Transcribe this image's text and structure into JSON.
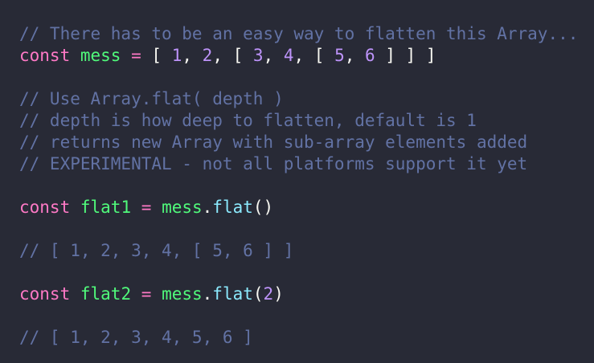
{
  "theme": {
    "background": "#282a36",
    "comment": "#6272a4",
    "keyword": "#ff79c6",
    "variable": "#50fa7b",
    "number": "#bd93f9",
    "method": "#8be9fd",
    "text": "#f8f8f2"
  },
  "lines": [
    {
      "tokens": [
        {
          "t": "// There has to be an easy way to flatten this Array...",
          "c": "comment"
        }
      ]
    },
    {
      "tokens": [
        {
          "t": "const",
          "c": "keyword"
        },
        {
          "t": " ",
          "c": "text"
        },
        {
          "t": "mess",
          "c": "variable"
        },
        {
          "t": " ",
          "c": "text"
        },
        {
          "t": "=",
          "c": "keyword"
        },
        {
          "t": " [ ",
          "c": "text"
        },
        {
          "t": "1",
          "c": "number"
        },
        {
          "t": ", ",
          "c": "text"
        },
        {
          "t": "2",
          "c": "number"
        },
        {
          "t": ", [ ",
          "c": "text"
        },
        {
          "t": "3",
          "c": "number"
        },
        {
          "t": ", ",
          "c": "text"
        },
        {
          "t": "4",
          "c": "number"
        },
        {
          "t": ", [ ",
          "c": "text"
        },
        {
          "t": "5",
          "c": "number"
        },
        {
          "t": ", ",
          "c": "text"
        },
        {
          "t": "6",
          "c": "number"
        },
        {
          "t": " ] ] ]",
          "c": "text"
        }
      ]
    },
    {
      "blank": true
    },
    {
      "tokens": [
        {
          "t": "// Use Array.flat( depth )",
          "c": "comment"
        }
      ]
    },
    {
      "tokens": [
        {
          "t": "// depth is how deep to flatten, default is 1",
          "c": "comment"
        }
      ]
    },
    {
      "tokens": [
        {
          "t": "// returns new Array with sub-array elements added",
          "c": "comment"
        }
      ]
    },
    {
      "tokens": [
        {
          "t": "// EXPERIMENTAL - not all platforms support it yet",
          "c": "comment"
        }
      ]
    },
    {
      "blank": true
    },
    {
      "tokens": [
        {
          "t": "const",
          "c": "keyword"
        },
        {
          "t": " ",
          "c": "text"
        },
        {
          "t": "flat1",
          "c": "variable"
        },
        {
          "t": " ",
          "c": "text"
        },
        {
          "t": "=",
          "c": "keyword"
        },
        {
          "t": " ",
          "c": "text"
        },
        {
          "t": "mess",
          "c": "variable"
        },
        {
          "t": ".",
          "c": "text"
        },
        {
          "t": "flat",
          "c": "method"
        },
        {
          "t": "()",
          "c": "text"
        }
      ]
    },
    {
      "blank": true
    },
    {
      "tokens": [
        {
          "t": "// [ 1, 2, 3, 4, [ 5, 6 ] ]",
          "c": "comment"
        }
      ]
    },
    {
      "blank": true
    },
    {
      "tokens": [
        {
          "t": "const",
          "c": "keyword"
        },
        {
          "t": " ",
          "c": "text"
        },
        {
          "t": "flat2",
          "c": "variable"
        },
        {
          "t": " ",
          "c": "text"
        },
        {
          "t": "=",
          "c": "keyword"
        },
        {
          "t": " ",
          "c": "text"
        },
        {
          "t": "mess",
          "c": "variable"
        },
        {
          "t": ".",
          "c": "text"
        },
        {
          "t": "flat",
          "c": "method"
        },
        {
          "t": "(",
          "c": "text"
        },
        {
          "t": "2",
          "c": "number"
        },
        {
          "t": ")",
          "c": "text"
        }
      ]
    },
    {
      "blank": true
    },
    {
      "tokens": [
        {
          "t": "// [ 1, 2, 3, 4, 5, 6 ]",
          "c": "comment"
        }
      ]
    }
  ]
}
